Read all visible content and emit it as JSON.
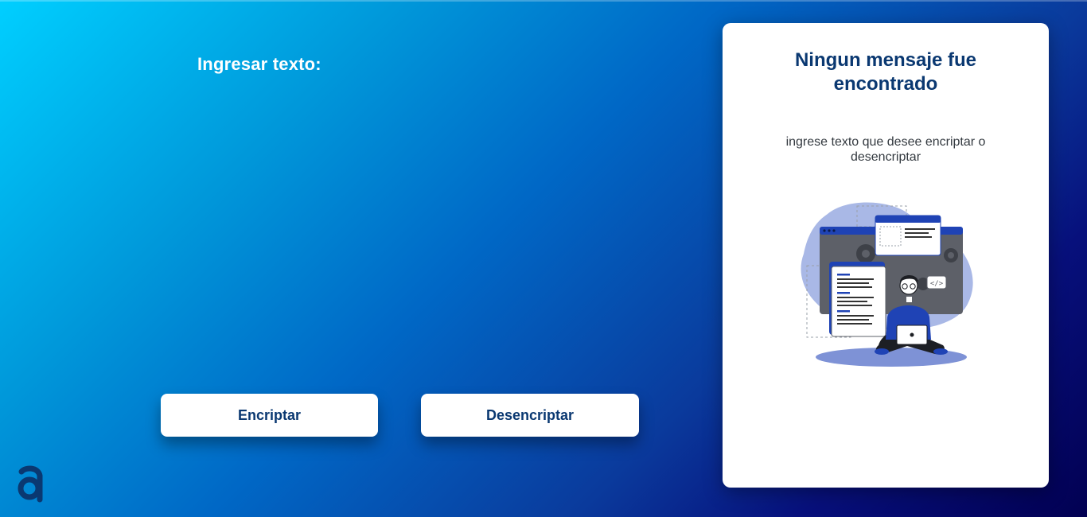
{
  "input": {
    "label": "Ingresar texto:",
    "value": ""
  },
  "buttons": {
    "encrypt_label": "Encriptar",
    "decrypt_label": "Desencriptar"
  },
  "result_card": {
    "title": "Ningun mensaje fue encontrado",
    "subtitle": "ingrese texto que desee encriptar o desencriptar"
  },
  "icons": {
    "logo": "alura-a-logo-icon",
    "illustration": "developer-laptop-illustration"
  },
  "colors": {
    "primary": "#0A3871",
    "gradient_start": "#00CFFF",
    "gradient_end": "#020052",
    "card_bg": "#FFFFFF"
  }
}
